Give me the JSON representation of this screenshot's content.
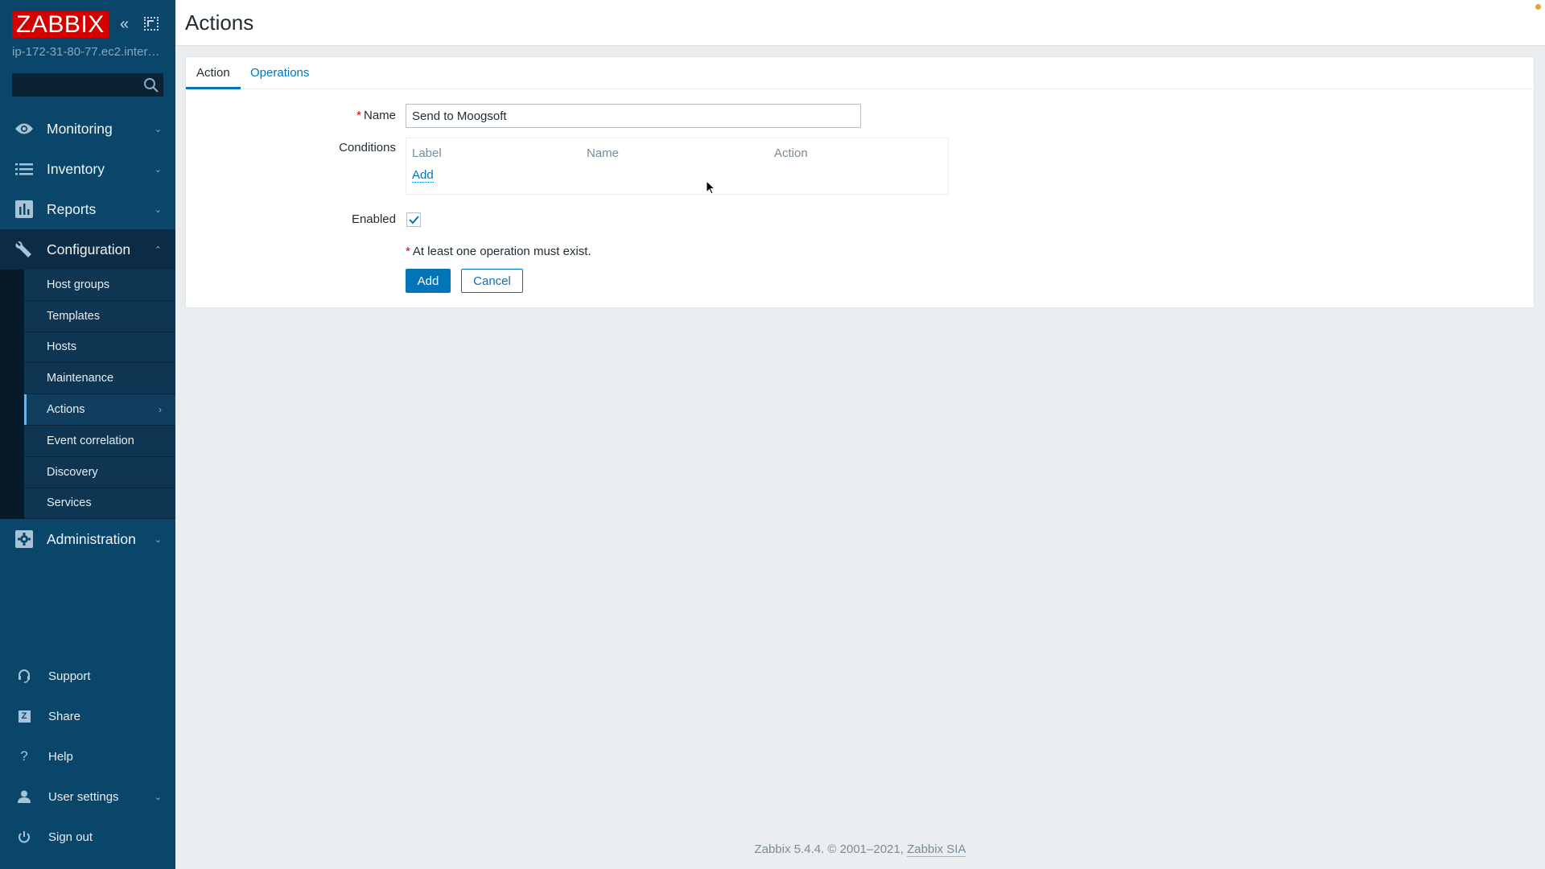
{
  "sidebar": {
    "logo": "ZABBIX",
    "server_name": "ip-172-31-80-77.ec2.inter…",
    "search": {
      "value": "",
      "placeholder": ""
    },
    "menu": [
      {
        "label": "Monitoring",
        "icon": "eye-icon",
        "expanded": false
      },
      {
        "label": "Inventory",
        "icon": "list-icon",
        "expanded": false
      },
      {
        "label": "Reports",
        "icon": "bar-chart-icon",
        "expanded": false
      },
      {
        "label": "Configuration",
        "icon": "wrench-icon",
        "expanded": true,
        "submenu": [
          {
            "label": "Host groups"
          },
          {
            "label": "Templates"
          },
          {
            "label": "Hosts"
          },
          {
            "label": "Maintenance"
          },
          {
            "label": "Actions",
            "active": true
          },
          {
            "label": "Event correlation"
          },
          {
            "label": "Discovery"
          },
          {
            "label": "Services"
          }
        ]
      },
      {
        "label": "Administration",
        "icon": "gear-icon",
        "expanded": false
      }
    ],
    "bottom": [
      {
        "label": "Support",
        "icon": "headset-icon"
      },
      {
        "label": "Share",
        "icon": "share-z-icon",
        "glyph": "Z"
      },
      {
        "label": "Help",
        "icon": "question-icon",
        "glyph": "?"
      },
      {
        "label": "User settings",
        "icon": "user-icon"
      },
      {
        "label": "Sign out",
        "icon": "power-icon"
      }
    ]
  },
  "header": {
    "title": "Actions"
  },
  "tabs": [
    {
      "label": "Action",
      "active": true
    },
    {
      "label": "Operations",
      "active": false
    }
  ],
  "form": {
    "name_label": "Name",
    "required_marker": "*",
    "name_value": "Send to Moogsoft",
    "conditions_label": "Conditions",
    "conditions_columns": [
      "Label",
      "Name",
      "Action"
    ],
    "conditions_add": "Add",
    "enabled_label": "Enabled",
    "enabled_checked": true,
    "warning": "At least one operation must exist.",
    "add_button": "Add",
    "cancel_button": "Cancel"
  },
  "footer": {
    "text": "Zabbix 5.4.4. © 2001–2021, ",
    "link": "Zabbix SIA"
  },
  "colors": {
    "sidebar_bg": "#0a466a",
    "logo_red": "#d40000",
    "accent_blue": "#0275b8",
    "notification": "#e8a33d"
  }
}
